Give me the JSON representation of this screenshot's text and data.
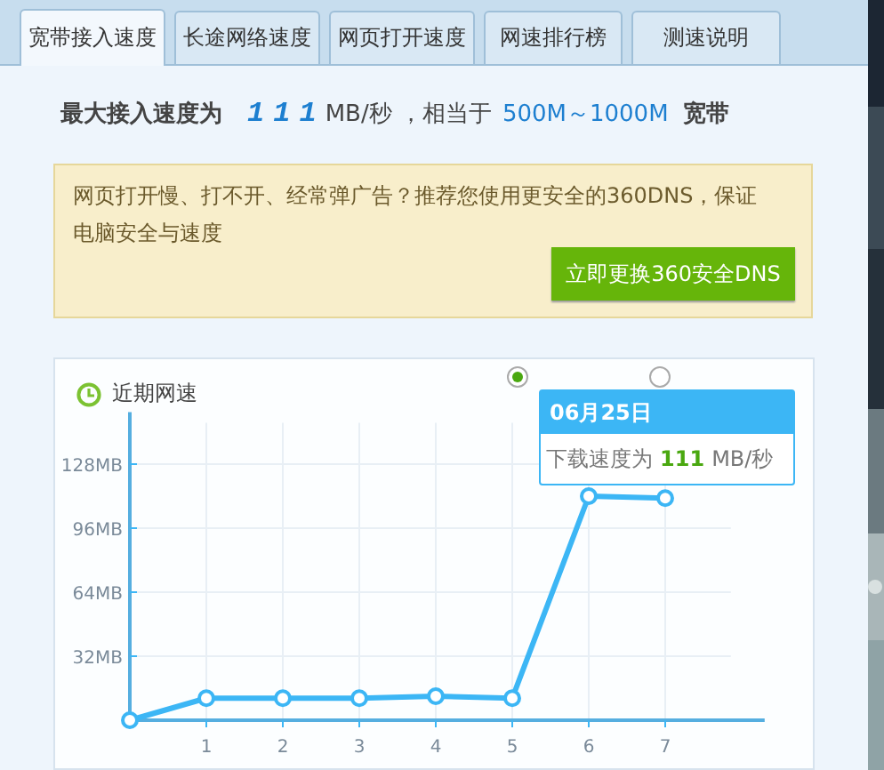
{
  "tabs": [
    {
      "label": "宽带接入速度",
      "selected": true
    },
    {
      "label": "长途网络速度",
      "selected": false
    },
    {
      "label": "网页打开速度",
      "selected": false
    },
    {
      "label": "网速排行榜",
      "selected": false
    },
    {
      "label": "测速说明",
      "selected": false
    }
  ],
  "headline": {
    "prefix": "最大接入速度为",
    "speed": "111",
    "unit": "MB/秒 ，相当于",
    "range": "500M～1000M",
    "suffix": "宽带"
  },
  "notice": {
    "text": "网页打开慢、打不开、经常弹广告？推荐您使用更安全的360DNS，保证电脑安全与速度",
    "button": "立即更换360安全DNS"
  },
  "recent": {
    "title": "近期网速",
    "radios": [
      {
        "selected": true
      },
      {
        "selected": false
      }
    ],
    "tooltip": {
      "date": "06月25日",
      "label": "下载速度为",
      "value": "111",
      "unit": "MB/秒"
    },
    "chart_data": {
      "type": "line",
      "x": [
        0,
        1,
        2,
        3,
        4,
        5,
        6,
        7
      ],
      "series": [
        {
          "color": "#3cb6f5",
          "marker": "circle",
          "values": [
            0,
            11,
            11,
            11,
            12,
            11,
            112,
            111
          ]
        }
      ],
      "xlim": [
        0,
        8.3
      ],
      "ylim": [
        0,
        154
      ],
      "grid": true,
      "xticks": [
        1,
        2,
        3,
        4,
        5,
        6,
        7
      ],
      "yticks": [
        {
          "value": 32,
          "label": "32MB"
        },
        {
          "value": 64,
          "label": "64MB"
        },
        {
          "value": 96,
          "label": "96MB"
        },
        {
          "value": 128,
          "label": "128MB"
        }
      ]
    }
  }
}
